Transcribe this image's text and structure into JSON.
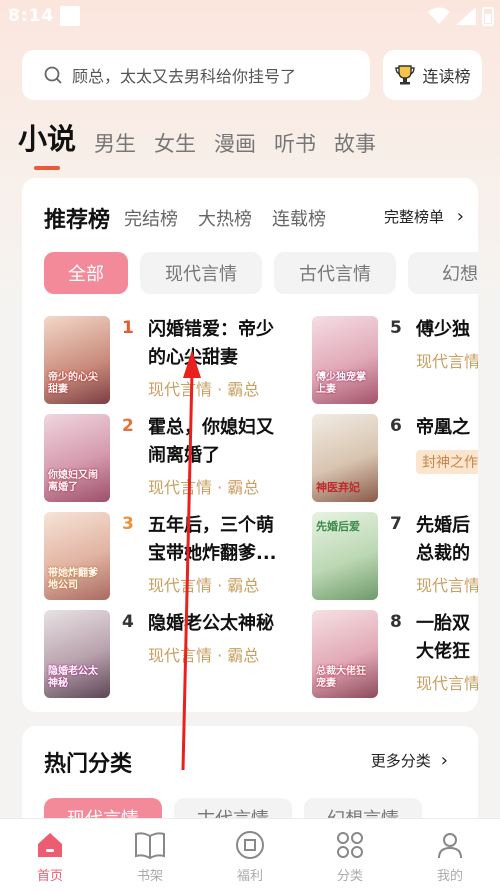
{
  "status_bar": {
    "time": "8:14"
  },
  "search": {
    "placeholder": "顾总，太太又去男科给你挂号了"
  },
  "rank_button": {
    "label": "连读榜"
  },
  "main_tabs": [
    "小说",
    "男生",
    "女生",
    "漫画",
    "听书",
    "故事"
  ],
  "ranking_card": {
    "title": "推荐榜",
    "sub_tabs": [
      "完结榜",
      "大热榜",
      "连载榜"
    ],
    "more_label": "完整榜单",
    "chips": [
      "全部",
      "现代言情",
      "古代言情",
      "幻想言"
    ],
    "books_left": [
      {
        "rank": "1",
        "title": "闪婚错爱：帝少\n的心尖甜妻",
        "tags": "现代言情 · 霸总",
        "cover_text": "帝少的心尖甜妻"
      },
      {
        "rank": "2",
        "title": "霍总，你媳妇又\n闹离婚了",
        "tags": "现代言情 · 霸总",
        "cover_text": "你媳妇又闹离婚了"
      },
      {
        "rank": "3",
        "title": "五年后，三个萌\n宝带她炸翻爹...",
        "tags": "现代言情 · 霸总",
        "cover_text": "带她炸翻爹地公司"
      },
      {
        "rank": "4",
        "title": "隐婚老公太神秘",
        "tags": "现代言情 · 霸总",
        "cover_text": "隐婚老公太神秘"
      }
    ],
    "books_right": [
      {
        "rank": "5",
        "title": "傅少独",
        "tags": "现代言情",
        "cover_text": "傅少独宠掌上妻"
      },
      {
        "rank": "6",
        "title": "帝凰之",
        "tags": "封神之作",
        "cover_text": "神医弃妃"
      },
      {
        "rank": "7",
        "title": "先婚后\n总裁的",
        "tags": "现代言情",
        "cover_text": "先婚后爱"
      },
      {
        "rank": "8",
        "title": "一胎双\n大佬狂",
        "tags": "现代言情",
        "cover_text": "总裁大佬狂宠妻"
      }
    ]
  },
  "category_card": {
    "title": "热门分类",
    "more_label": "更多分类",
    "chips": [
      "现代言情",
      "古代言情",
      "幻想言情"
    ]
  },
  "bottom_nav": [
    {
      "label": "首页",
      "icon": "home-icon"
    },
    {
      "label": "书架",
      "icon": "book-icon"
    },
    {
      "label": "福利",
      "icon": "gift-icon"
    },
    {
      "label": "分类",
      "icon": "grid-icon"
    },
    {
      "label": "我的",
      "icon": "user-icon"
    }
  ],
  "colors": {
    "accent": "#ee5c72",
    "rank_red": "#e25b35",
    "tag_gold": "#c8a062"
  }
}
